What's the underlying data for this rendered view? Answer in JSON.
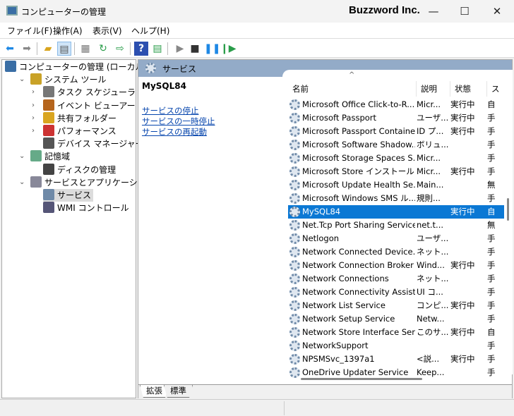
{
  "window": {
    "title": "コンピューターの管理",
    "brand": "Buzzword Inc.",
    "minimize": "—",
    "maximize": "☐",
    "close": "✕"
  },
  "menu": [
    "ファイル(F)",
    "操作(A)",
    "表示(V)",
    "ヘルプ(H)"
  ],
  "toolbar": {
    "icons": [
      "back-icon",
      "forward-icon",
      "up-folder-icon",
      "show-hide-tree-icon",
      "properties-icon",
      "refresh-icon",
      "export-list-icon",
      "help-icon",
      "action-pane-icon",
      "start-service-icon",
      "stop-service-icon",
      "pause-service-icon",
      "resume-service-icon"
    ]
  },
  "tree": [
    {
      "label": "コンピューターの管理 (ローカル)",
      "level": 0,
      "expander": ""
    },
    {
      "label": "システム ツール",
      "level": 1,
      "expander": "⌄"
    },
    {
      "label": "タスク スケジューラ",
      "level": 2,
      "expander": "›"
    },
    {
      "label": "イベント ビューアー",
      "level": 2,
      "expander": "›"
    },
    {
      "label": "共有フォルダー",
      "level": 2,
      "expander": "›"
    },
    {
      "label": "パフォーマンス",
      "level": 2,
      "expander": "›"
    },
    {
      "label": "デバイス マネージャー",
      "level": 2,
      "expander": ""
    },
    {
      "label": "記憶域",
      "level": 1,
      "expander": "⌄"
    },
    {
      "label": "ディスクの管理",
      "level": 2,
      "expander": ""
    },
    {
      "label": "サービスとアプリケーション",
      "level": 1,
      "expander": "⌄"
    },
    {
      "label": "サービス",
      "level": 2,
      "expander": "",
      "selected": true
    },
    {
      "label": "WMI コントロール",
      "level": 2,
      "expander": ""
    }
  ],
  "pane": {
    "title": "サービス",
    "selected_service": "MySQL84",
    "links": [
      "サービスの停止",
      "サービスの一時停止",
      "サービスの再起動"
    ]
  },
  "columns": [
    "名前",
    "説明",
    "状態",
    "ス"
  ],
  "services": [
    [
      "Microsoft Office Click-to-R...",
      "Micr...",
      "実行中",
      "自"
    ],
    [
      "Microsoft Passport",
      "ユーザ...",
      "実行中",
      "手"
    ],
    [
      "Microsoft Passport Container",
      "ID プ...",
      "実行中",
      "手"
    ],
    [
      "Microsoft Software Shadow...",
      "ボリュ...",
      "",
      "手"
    ],
    [
      "Microsoft Storage Spaces S...",
      "Micr...",
      "",
      "手"
    ],
    [
      "Microsoft Store インストール ...",
      "Micr...",
      "実行中",
      "手"
    ],
    [
      "Microsoft Update Health Se...",
      "Main...",
      "",
      "無"
    ],
    [
      "Microsoft Windows SMS ル...",
      "規則...",
      "",
      "手"
    ],
    [
      "MySQL84",
      "",
      "実行中",
      "自"
    ],
    [
      "Net.Tcp Port Sharing Service",
      "net.t...",
      "",
      "無"
    ],
    [
      "Netlogon",
      "ユーザ...",
      "",
      "手"
    ],
    [
      "Network Connected Device...",
      "ネット...",
      "",
      "手"
    ],
    [
      "Network Connection Broker",
      "Wind...",
      "実行中",
      "手"
    ],
    [
      "Network Connections",
      "ネット...",
      "",
      "手"
    ],
    [
      "Network Connectivity Assist...",
      "UI コ...",
      "",
      "手"
    ],
    [
      "Network List Service",
      "コンピ...",
      "実行中",
      "手"
    ],
    [
      "Network Setup Service",
      "Netw...",
      "",
      "手"
    ],
    [
      "Network Store Interface Ser...",
      "このサ...",
      "実行中",
      "自"
    ],
    [
      "NetworkSupport",
      "",
      "",
      "手"
    ],
    [
      "NPSMSvc_1397a1",
      "<説...",
      "実行中",
      "手"
    ],
    [
      "OneDrive Updater Service",
      "Keep...",
      "",
      "手"
    ]
  ],
  "selected_index": 8,
  "tabs": [
    "拡張",
    "標準"
  ],
  "colors": {
    "accent": "#0b78d4",
    "band": "#93abc8"
  }
}
